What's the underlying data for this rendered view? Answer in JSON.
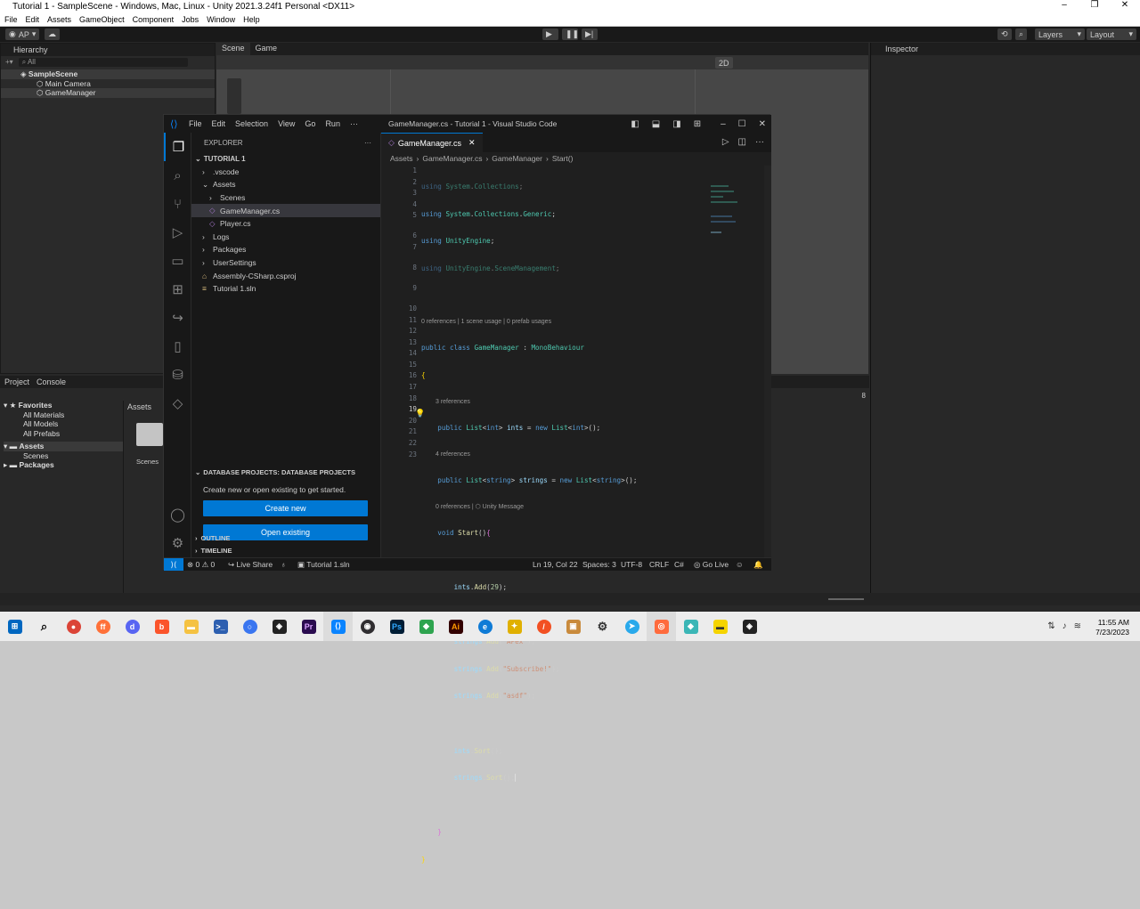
{
  "unity": {
    "title": "Tutorial 1 - SampleScene - Windows, Mac, Linux - Unity 2021.3.24f1 Personal <DX11>",
    "window_controls": [
      "–",
      "❐",
      "✕"
    ],
    "menu": [
      "File",
      "Edit",
      "Assets",
      "GameObject",
      "Component",
      "Jobs",
      "Window",
      "Help"
    ],
    "account": "AP",
    "layers": "Layers",
    "layout": "Layout",
    "hierarchy": {
      "tab": "Hierarchy",
      "search": "All",
      "scene": "SampleScene",
      "items": [
        "Main Camera",
        "GameManager"
      ]
    },
    "scene_tabs": [
      "Scene",
      "Game"
    ],
    "scene_2d": "2D",
    "inspector_tab": "Inspector",
    "project": {
      "tabs": [
        "Project",
        "Console"
      ],
      "favorites": "Favorites",
      "fav_items": [
        "All Materials",
        "All Models",
        "All Prefabs"
      ],
      "assets": "Assets",
      "asset_items": [
        "Scenes"
      ],
      "packages": "Packages",
      "breadcrumb": "Assets",
      "folder": "Scenes",
      "hidden_count": "8"
    }
  },
  "vscode": {
    "menu": [
      "File",
      "Edit",
      "Selection",
      "View",
      "Go",
      "Run",
      "···"
    ],
    "title": "GameManager.cs - Tutorial 1 - Visual Studio Code",
    "explorer": "EXPLORER",
    "workspace": "TUTORIAL 1",
    "tree": [
      {
        "label": ".vscode",
        "indent": 1,
        "chev": "›"
      },
      {
        "label": "Assets",
        "indent": 1,
        "chev": "⌄"
      },
      {
        "label": "Scenes",
        "indent": 2,
        "chev": "›"
      },
      {
        "label": "GameManager.cs",
        "indent": 2,
        "chev": "",
        "selected": true
      },
      {
        "label": "Player.cs",
        "indent": 2,
        "chev": ""
      },
      {
        "label": "Logs",
        "indent": 1,
        "chev": "›"
      },
      {
        "label": "Packages",
        "indent": 1,
        "chev": "›"
      },
      {
        "label": "UserSettings",
        "indent": 1,
        "chev": "›"
      },
      {
        "label": "Assembly-CSharp.csproj",
        "indent": 1,
        "chev": ""
      },
      {
        "label": "Tutorial 1.sln",
        "indent": 1,
        "chev": ""
      }
    ],
    "db_header": "DATABASE PROJECTS: DATABASE PROJECTS",
    "db_text": "Create new or open existing to get started.",
    "btn_new": "Create new",
    "btn_open": "Open existing",
    "outline": "OUTLINE",
    "timeline": "TIMELINE",
    "tab": "GameManager.cs",
    "breadcrumbs": [
      "Assets",
      "GameManager.cs",
      "GameManager",
      "Start()"
    ],
    "code_lens": {
      "class": "0 references | 1 scene usage | 0 prefab usages",
      "ints": "3 references",
      "strings": "4 references",
      "start": "0 references | ⬡ Unity Message"
    },
    "status": {
      "errors": "⊗ 0 ⚠ 0",
      "live_share": "Live Share",
      "sln": "Tutorial 1.sln",
      "position": "Ln 19, Col 22",
      "spaces": "Spaces: 3",
      "encoding": "UTF-8",
      "eol": "CRLF",
      "lang": "C#",
      "golive": "Go Live"
    }
  },
  "taskbar": {
    "time": "11:55 AM",
    "date": "7/23/2023",
    "badge": "8"
  }
}
